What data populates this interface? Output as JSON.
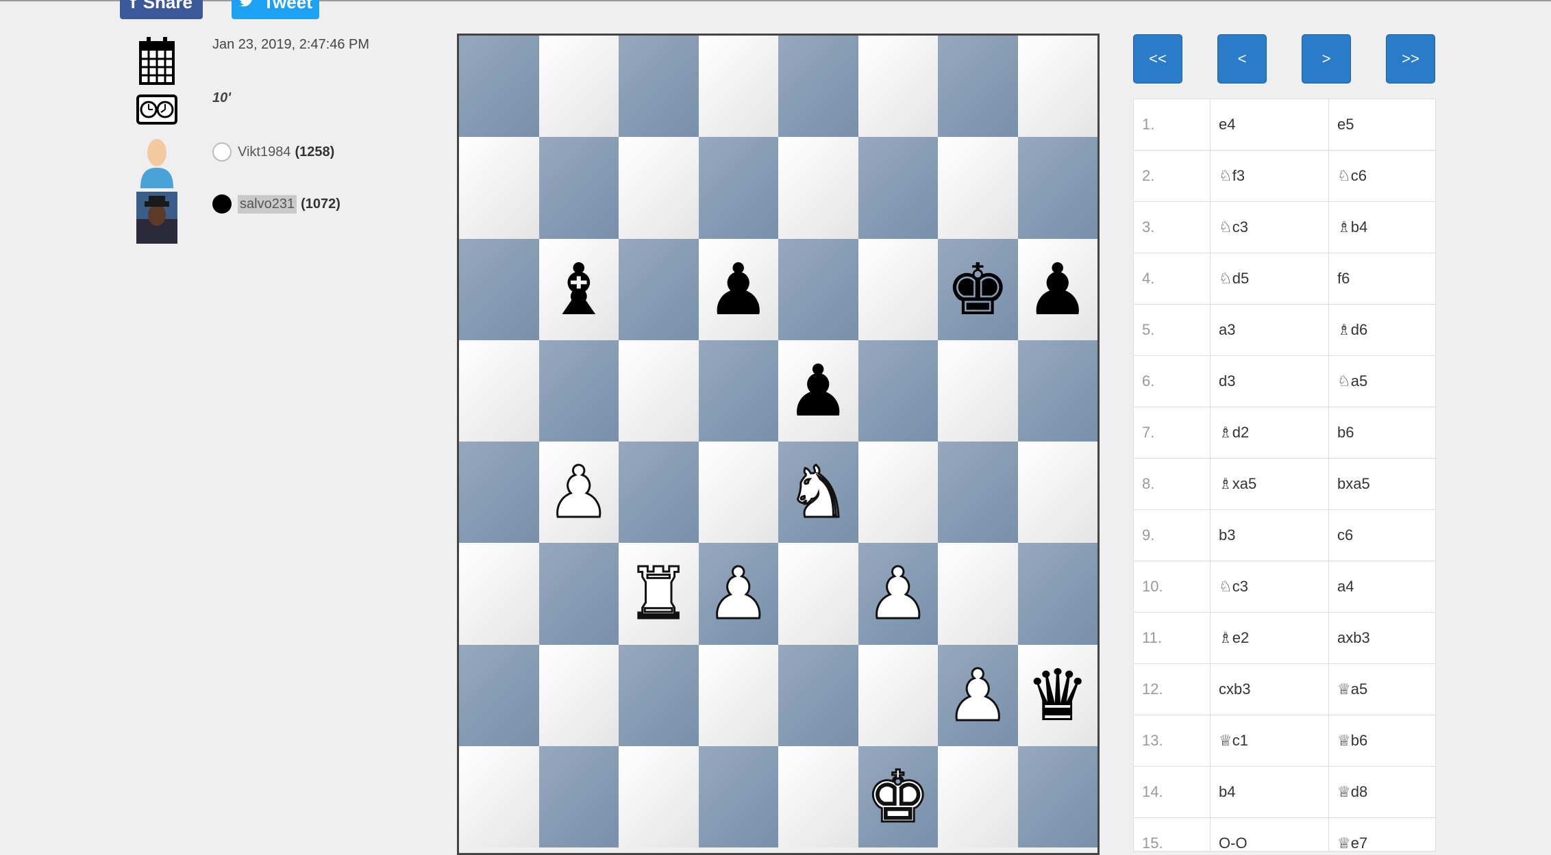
{
  "social": {
    "share_label": "Share",
    "tweet_label": "Tweet",
    "share_icon": "facebook-icon",
    "tweet_icon": "twitter-icon"
  },
  "game_info": {
    "date": "Jan 23, 2019, 2:47:46 PM",
    "time_control": "10'",
    "white_player": {
      "name": "Vikt1984",
      "rating": "(1258)"
    },
    "black_player": {
      "name": "salvo231",
      "rating": "(1072)"
    }
  },
  "board": {
    "colors": {
      "light": "#ffffff",
      "dark": "#8499b1"
    },
    "pieces": [
      {
        "square": "b6",
        "glyph": "♝",
        "color": "black",
        "piece": "bishop"
      },
      {
        "square": "d6",
        "glyph": "♟",
        "color": "black",
        "piece": "pawn"
      },
      {
        "square": "g6",
        "glyph": "♚",
        "color": "black",
        "piece": "king"
      },
      {
        "square": "h6",
        "glyph": "♟",
        "color": "black",
        "piece": "pawn"
      },
      {
        "square": "e5",
        "glyph": "♟",
        "color": "black",
        "piece": "pawn"
      },
      {
        "square": "b4",
        "glyph": "♟",
        "color": "white",
        "piece": "pawn"
      },
      {
        "square": "e4",
        "glyph": "♞",
        "color": "white",
        "piece": "knight"
      },
      {
        "square": "c3",
        "glyph": "♜",
        "color": "white",
        "piece": "rook"
      },
      {
        "square": "d3",
        "glyph": "♟",
        "color": "white",
        "piece": "pawn"
      },
      {
        "square": "f3",
        "glyph": "♟",
        "color": "white",
        "piece": "pawn"
      },
      {
        "square": "g2",
        "glyph": "♟",
        "color": "white",
        "piece": "pawn"
      },
      {
        "square": "h2",
        "glyph": "♛",
        "color": "black",
        "piece": "queen"
      },
      {
        "square": "f1",
        "glyph": "♚",
        "color": "white",
        "piece": "king"
      }
    ]
  },
  "nav": {
    "first": "<<",
    "prev": "<",
    "next": ">",
    "last": ">>"
  },
  "moves": [
    {
      "num": "1.",
      "white": "e4",
      "black": "e5"
    },
    {
      "num": "2.",
      "white": "♘f3",
      "black": "♘c6"
    },
    {
      "num": "3.",
      "white": "♘c3",
      "black": "♗b4"
    },
    {
      "num": "4.",
      "white": "♘d5",
      "black": "f6"
    },
    {
      "num": "5.",
      "white": "a3",
      "black": "♗d6"
    },
    {
      "num": "6.",
      "white": "d3",
      "black": "♘a5"
    },
    {
      "num": "7.",
      "white": "♗d2",
      "black": "b6"
    },
    {
      "num": "8.",
      "white": "♗xa5",
      "black": "bxa5"
    },
    {
      "num": "9.",
      "white": "b3",
      "black": "c6"
    },
    {
      "num": "10.",
      "white": "♘c3",
      "black": "a4"
    },
    {
      "num": "11.",
      "white": "♗e2",
      "black": "axb3"
    },
    {
      "num": "12.",
      "white": "cxb3",
      "black": "♕a5"
    },
    {
      "num": "13.",
      "white": "♕c1",
      "black": "♕b6"
    },
    {
      "num": "14.",
      "white": "b4",
      "black": "♕d8"
    },
    {
      "num": "15.",
      "white": "O-O",
      "black": "♕e7"
    }
  ]
}
